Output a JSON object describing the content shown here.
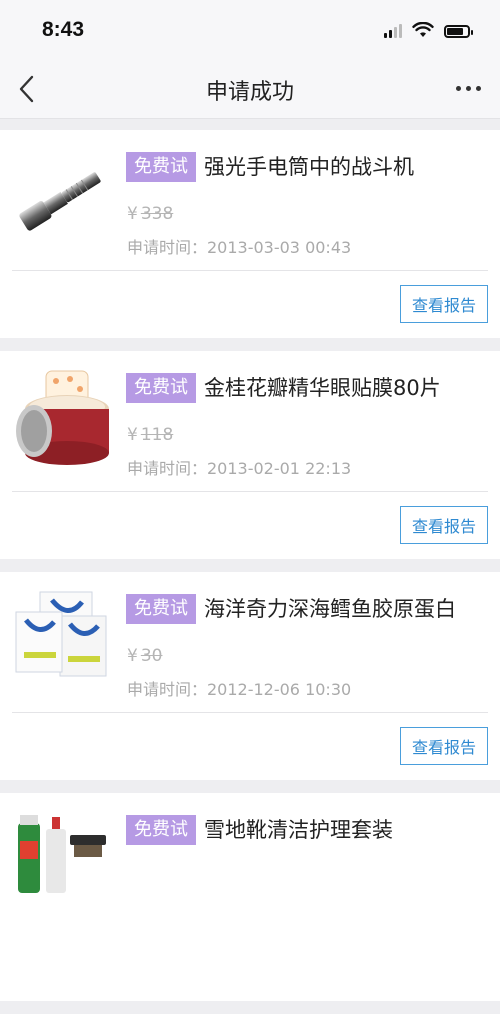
{
  "status": {
    "time": "8:43"
  },
  "nav": {
    "title": "申请成功"
  },
  "items": [
    {
      "tag": "免费试",
      "name": "强光手电筒中的战斗机",
      "currency": "¥",
      "price": "338",
      "date": "申请时间：2013-03-03 00:43",
      "button": "查看报告",
      "image": "flashlight"
    },
    {
      "tag": "免费试",
      "name": "金桂花瓣精华眼贴膜80片",
      "currency": "¥",
      "price": "118",
      "date": "申请时间：2013-02-01 22:13",
      "button": "查看报告",
      "image": "eye-mask-jar"
    },
    {
      "tag": "免费试",
      "name": "海洋奇力深海鳕鱼胶原蛋白",
      "currency": "¥",
      "price": "30",
      "date": "申请时间：2012-12-06 10:30",
      "button": "查看报告",
      "image": "collagen-sachets"
    },
    {
      "tag": "免费试",
      "name": "雪地靴清洁护理套装",
      "currency": "",
      "price": "",
      "date": "",
      "button": "",
      "image": "boot-care-kit"
    }
  ]
}
